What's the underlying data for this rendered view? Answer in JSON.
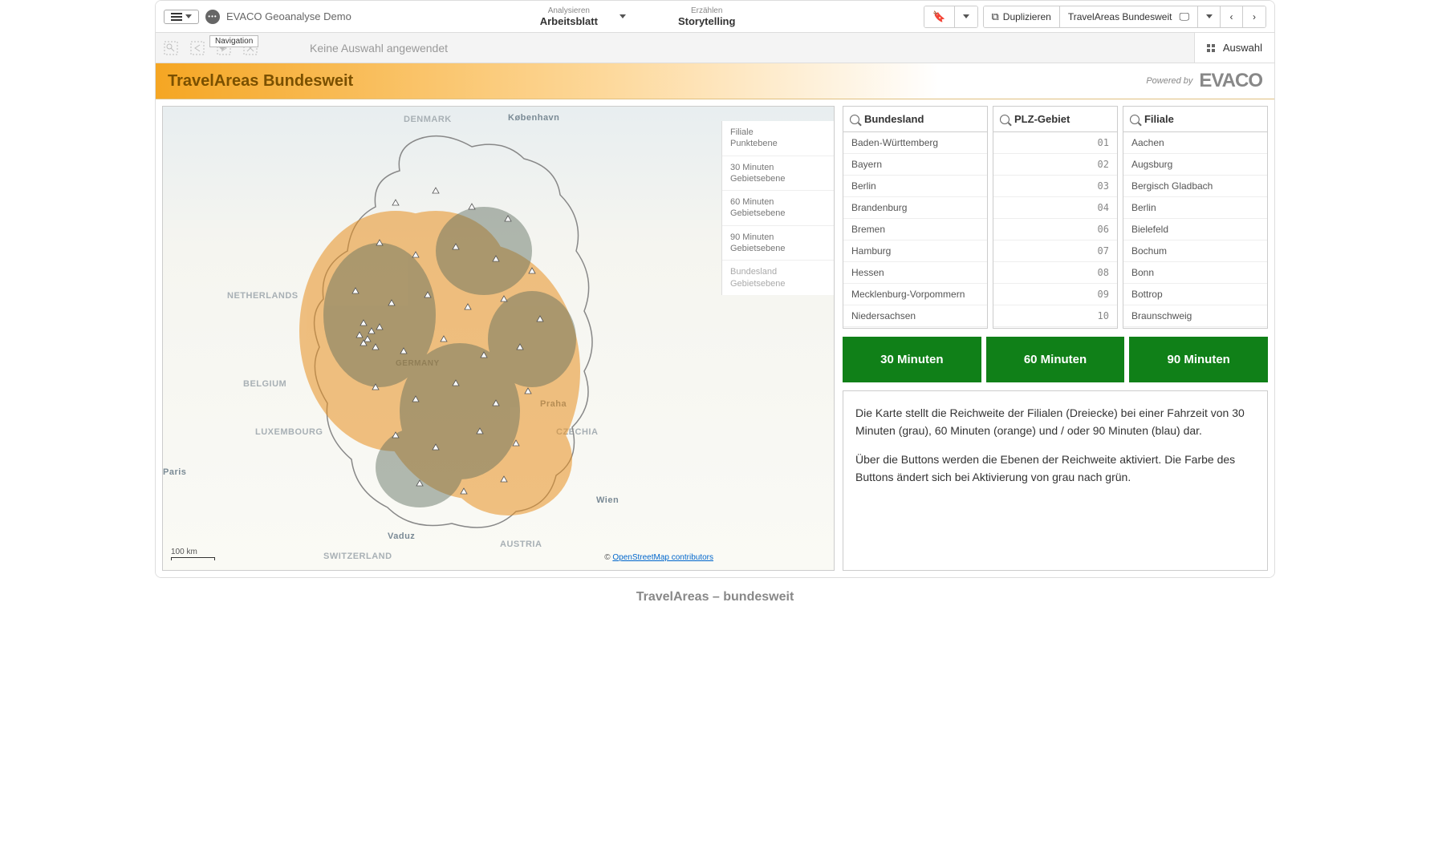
{
  "app_title": "EVACO Geoanalyse Demo",
  "nav": {
    "analyze_small": "Analysieren",
    "analyze_main": "Arbeitsblatt",
    "story_small": "Erzählen",
    "story_main": "Storytelling"
  },
  "toolbar": {
    "duplicate": "Duplizieren",
    "sheet_name": "TravelAreas Bundesweit"
  },
  "selection": {
    "nav_tooltip": "Navigation",
    "no_selection": "Keine Auswahl angewendet",
    "selection_label": "Auswahl"
  },
  "title_bar": {
    "sheet_title": "TravelAreas Bundesweit",
    "powered_by": "Powered by",
    "logo": "EVACO"
  },
  "map": {
    "labels": {
      "denmark": "DENMARK",
      "kopenhaven": "København",
      "netherlands": "NETHERLANDS",
      "belgium": "BELGIUM",
      "luxembourg": "LUXEMBOURG",
      "paris": "Paris",
      "praha": "Praha",
      "czechia": "CZECHIA",
      "wien": "Wien",
      "austria": "AUSTRIA",
      "switzerland": "SWITZERLAND",
      "vaduz": "Vaduz",
      "germany": "GERMANY"
    },
    "scale": "100 km",
    "attribution_prefix": "© ",
    "attribution_link": "OpenStreetMap contributors",
    "layers": [
      {
        "l1": "Filiale",
        "l2": "Punktebene"
      },
      {
        "l1": "30 Minuten",
        "l2": "Gebietsebene"
      },
      {
        "l1": "60 Minuten",
        "l2": "Gebietsebene"
      },
      {
        "l1": "90 Minuten",
        "l2": "Gebietsebene"
      },
      {
        "l1": "Bundesland",
        "l2": "Gebietsebene"
      }
    ]
  },
  "filters": {
    "bundesland": {
      "title": "Bundesland",
      "items": [
        "Baden-Württemberg",
        "Bayern",
        "Berlin",
        "Brandenburg",
        "Bremen",
        "Hamburg",
        "Hessen",
        "Mecklenburg-Vorpommern",
        "Niedersachsen"
      ]
    },
    "plz": {
      "title": "PLZ-Gebiet",
      "items": [
        "01",
        "02",
        "03",
        "04",
        "06",
        "07",
        "08",
        "09",
        "10"
      ]
    },
    "filiale": {
      "title": "Filiale",
      "items": [
        "Aachen",
        "Augsburg",
        "Bergisch Gladbach",
        "Berlin",
        "Bielefeld",
        "Bochum",
        "Bonn",
        "Bottrop",
        "Braunschweig"
      ]
    }
  },
  "buttons": {
    "b30": "30 Minuten",
    "b60": "60 Minuten",
    "b90": "90 Minuten"
  },
  "description": {
    "p1": "Die Karte stellt die Reichweite der Filialen (Dreiecke) bei einer Fahrzeit von 30 Minuten (grau), 60 Minuten (orange) und / oder 90 Minuten (blau) dar.",
    "p2": "Über die Buttons werden die Ebenen der Reichweite aktiviert. Die Farbe des Buttons ändert sich bei Aktivierung von grau nach grün."
  },
  "caption": "TravelAreas – bundesweit"
}
